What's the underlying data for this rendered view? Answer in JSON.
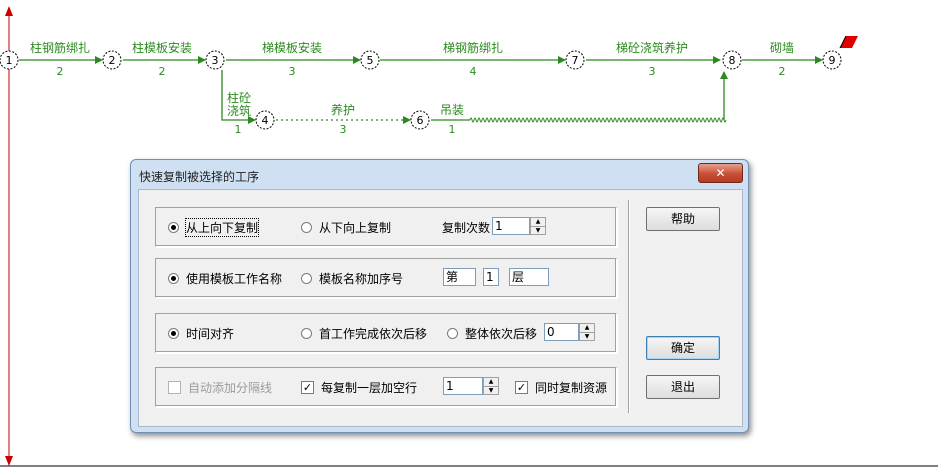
{
  "network": {
    "nodes": [
      "1",
      "2",
      "3",
      "4",
      "5",
      "6",
      "7",
      "8",
      "9"
    ],
    "activities": [
      {
        "name": "柱钢筋绑扎",
        "duration": "2"
      },
      {
        "name": "柱模板安装",
        "duration": "2"
      },
      {
        "name": "梯模板安装",
        "duration": "3"
      },
      {
        "name": "梯钢筋绑扎",
        "duration": "4"
      },
      {
        "name": "梯砼浇筑养护",
        "duration": "3"
      },
      {
        "name": "砌墙",
        "duration": "2"
      },
      {
        "name": "柱砼",
        "name2": "浇筑",
        "duration": "1"
      },
      {
        "name": "养护",
        "duration": "3"
      },
      {
        "name": "吊装",
        "duration": "1"
      }
    ],
    "colors": {
      "arrow": "#2b8a1f",
      "node_border": "#000000",
      "timeline": "#cc0000",
      "flag": "#e00000"
    }
  },
  "dialog": {
    "title": "快速复制被选择的工序",
    "close_label": "✕",
    "copy_direction": {
      "option_top_down": "从上向下复制",
      "option_bottom_up": "从下向上复制",
      "selected": "top_down",
      "count_label": "复制次数",
      "count_value": "1"
    },
    "naming": {
      "option_template_name": "使用模板工作名称",
      "option_name_with_seq": "模板名称加序号",
      "selected": "template_name",
      "prefix_value": "第",
      "number_value": "1",
      "suffix_value": "层"
    },
    "alignment": {
      "option_time_align": "时间对齐",
      "option_first_work": "首工作完成依次后移",
      "option_whole_shift": "整体依次后移",
      "selected": "time_align",
      "shift_value": "0"
    },
    "extras": {
      "auto_separator_label": "自动添加分隔线",
      "auto_separator_checked": false,
      "blank_row_label": "每复制一层加空行",
      "blank_row_checked": true,
      "blank_row_value": "1",
      "copy_resources_label": "同时复制资源",
      "copy_resources_checked": true
    },
    "buttons": {
      "help": "帮助",
      "ok": "确定",
      "exit": "退出"
    }
  }
}
